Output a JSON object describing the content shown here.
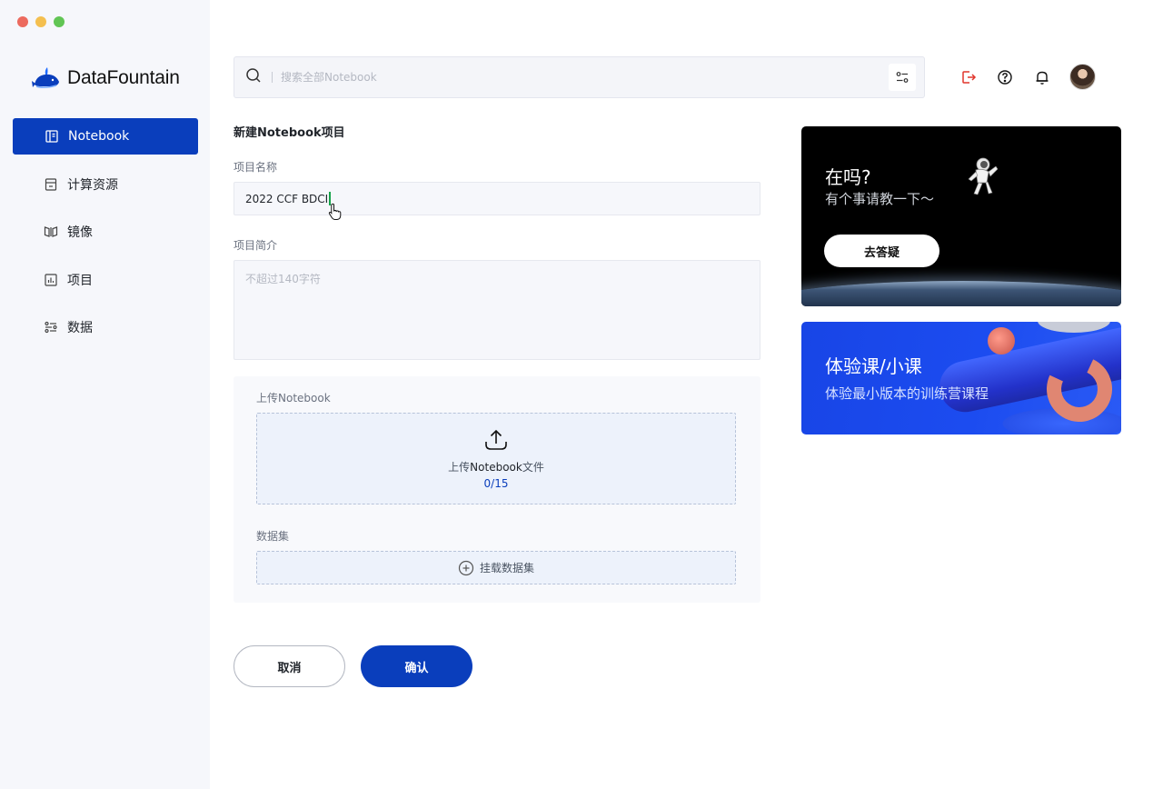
{
  "window": {
    "controls": [
      "#ec6a5e",
      "#f4bf4f",
      "#61c554"
    ]
  },
  "brand": {
    "name": "DataFountain",
    "color": "#0a3ebc"
  },
  "sidebar": {
    "items": [
      {
        "label": "Notebook",
        "icon": "notebook-icon",
        "active": true
      },
      {
        "label": "计算资源",
        "icon": "compute-icon",
        "active": false
      },
      {
        "label": "镜像",
        "icon": "mirror-icon",
        "active": false
      },
      {
        "label": "项目",
        "icon": "project-icon",
        "active": false
      },
      {
        "label": "数据",
        "icon": "data-icon",
        "active": false
      }
    ]
  },
  "search": {
    "placeholder": "搜索全部Notebook",
    "value": ""
  },
  "header": {
    "icons": [
      "logout-icon",
      "help-icon",
      "bell-icon",
      "avatar"
    ]
  },
  "form": {
    "title": "新建Notebook项目",
    "name_label": "项目名称",
    "name_value": "2022 CCF BDCI",
    "desc_label": "项目简介",
    "desc_placeholder": "不超过140字符",
    "upload_label": "上传Notebook",
    "upload_text_prefix": "上传",
    "upload_text_bold": "Notebook",
    "upload_text_suffix": "文件",
    "upload_count": "0/15",
    "dataset_label": "数据集",
    "mount_label": "挂载数据集",
    "cancel": "取消",
    "confirm": "确认"
  },
  "promo": {
    "card1": {
      "title": "在吗?",
      "subtitle": "有个事请教一下～",
      "button": "去答疑"
    },
    "card2": {
      "title": "体验课/小课",
      "subtitle": "体验最小版本的训练营课程"
    }
  }
}
